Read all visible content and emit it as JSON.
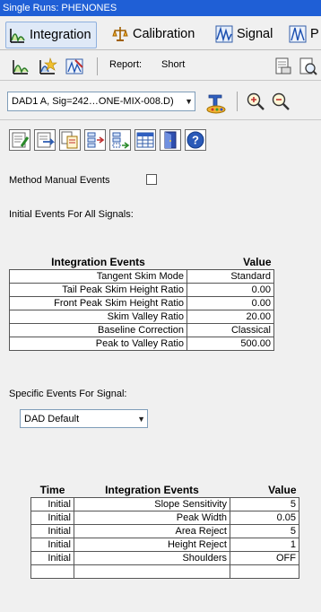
{
  "window": {
    "title": "Single Runs: PHENONES"
  },
  "tabs": [
    {
      "label": "Integration",
      "icon": "integration-icon",
      "active": true
    },
    {
      "label": "Calibration",
      "icon": "calibration-icon",
      "active": false
    },
    {
      "label": "Signal",
      "icon": "signal-icon",
      "active": false
    },
    {
      "label": "P",
      "icon": "peak-icon",
      "active": false
    }
  ],
  "toolbar": {
    "report_label": "Report:",
    "report_value": "Short"
  },
  "signal_select": {
    "value": "DAD1 A, Sig=242…ONE-MIX-008.D)"
  },
  "method_manual_events": {
    "label": "Method Manual Events",
    "checked": false
  },
  "initial_events": {
    "heading": "Initial Events For All Signals:",
    "columns": [
      "Integration Events",
      "Value"
    ],
    "rows": [
      [
        "Tangent Skim Mode",
        "Standard"
      ],
      [
        "Tail Peak Skim Height Ratio",
        "0.00"
      ],
      [
        "Front Peak Skim Height Ratio",
        "0.00"
      ],
      [
        "Skim Valley Ratio",
        "20.00"
      ],
      [
        "Baseline Correction",
        "Classical"
      ],
      [
        "Peak to Valley Ratio",
        "500.00"
      ]
    ]
  },
  "specific_events": {
    "heading": "Specific Events For Signal:",
    "select_value": "DAD Default",
    "columns": [
      "Time",
      "Integration Events",
      "Value"
    ],
    "rows": [
      [
        "Initial",
        "Slope Sensitivity",
        "5"
      ],
      [
        "Initial",
        "Peak Width",
        "0.05"
      ],
      [
        "Initial",
        "Area Reject",
        "5"
      ],
      [
        "Initial",
        "Height Reject",
        "1"
      ],
      [
        "Initial",
        "Shoulders",
        "OFF"
      ],
      [
        "",
        "",
        ""
      ]
    ]
  },
  "colors": {
    "title_bar": "#1f5fd6",
    "tab_active": "#dfe9f7",
    "background": "#f0f0f0"
  }
}
